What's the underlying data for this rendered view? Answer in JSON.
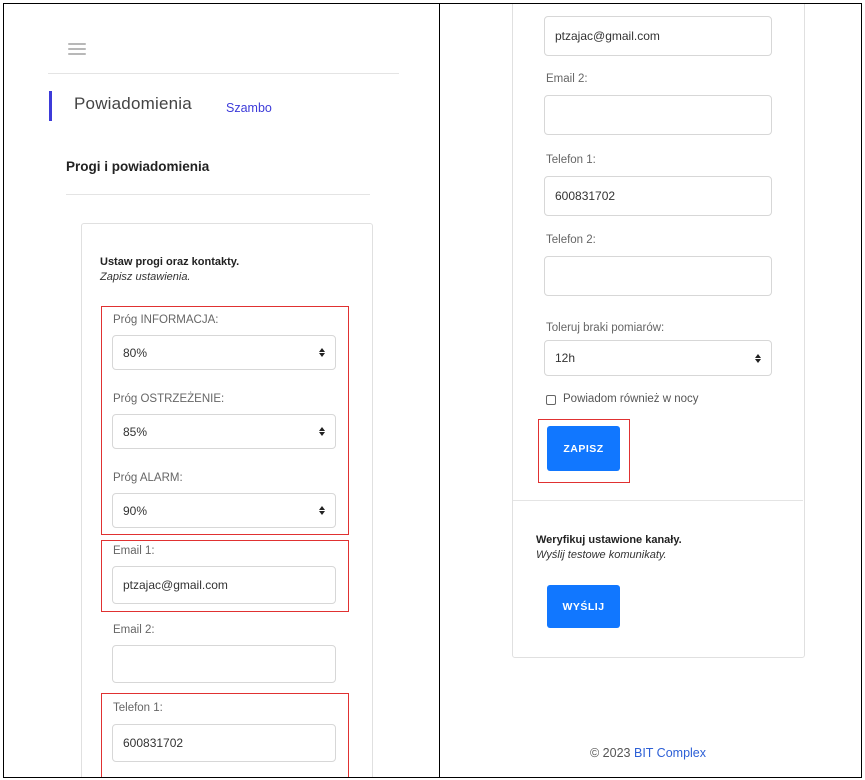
{
  "left": {
    "page_title": "Powiadomienia",
    "breadcrumb": "Szambo",
    "section_heading": "Progi i powiadomienia",
    "card_heading": "Ustaw progi oraz kontakty.",
    "card_subheading": "Zapisz ustawienia.",
    "threshold_info": {
      "label": "Próg  INFORMACJA:",
      "value": "80%"
    },
    "threshold_warning": {
      "label": "Próg  OSTRZEŻENIE:",
      "value": "85%"
    },
    "threshold_alarm": {
      "label": "Próg  ALARM:",
      "value": "90%"
    },
    "email1": {
      "label": "Email 1:",
      "value": "ptzajac@gmail.com"
    },
    "email2": {
      "label": "Email 2:",
      "value": ""
    },
    "phone1": {
      "label": "Telefon 1:",
      "value": "600831702"
    }
  },
  "right": {
    "email1_value": "ptzajac@gmail.com",
    "email2": {
      "label": "Email 2:",
      "value": ""
    },
    "phone1": {
      "label": "Telefon 1:",
      "value": "600831702"
    },
    "phone2": {
      "label": "Telefon 2:",
      "value": ""
    },
    "tolerance": {
      "label": "Toleruj braki pomiarów:",
      "value": "12h"
    },
    "night_checkbox_label": "Powiadom również w nocy",
    "night_checked": false,
    "save_button": "ZAPISZ",
    "verify_heading": "Weryfikuj ustawione kanały.",
    "verify_subheading": "Wyślij testowe komunikaty.",
    "send_button": "WYŚLIJ",
    "footer_copyright": "© 2023",
    "footer_brand": "BIT Complex"
  },
  "colors": {
    "accent": "#3d3bd9",
    "button": "#1177ff",
    "highlight": "#e03131",
    "brand_link": "#2c5fd6"
  },
  "icons": [
    "menu-icon",
    "select-caret-icon",
    "checkbox"
  ]
}
